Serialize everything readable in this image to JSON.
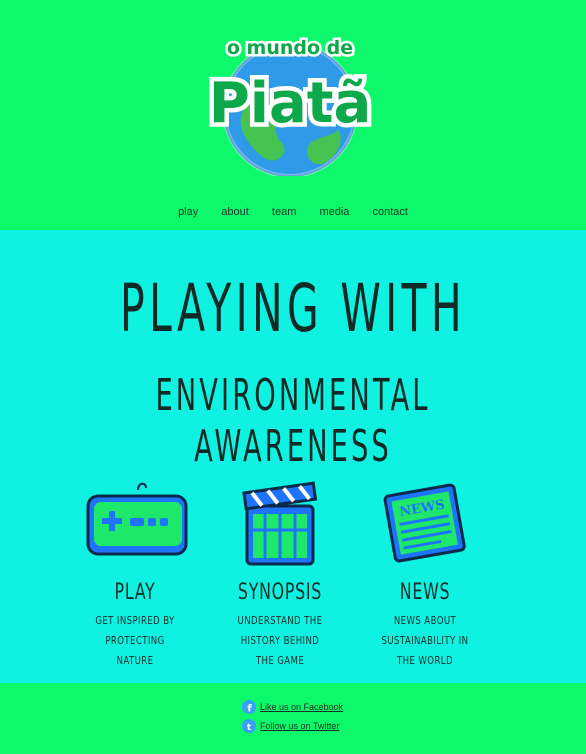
{
  "header": {
    "logo_small": "o mundo de",
    "logo_big": "Piatã"
  },
  "nav": [
    "play",
    "about",
    "team",
    "media",
    "contact"
  ],
  "hero": {
    "line1": "PLAYING WITH",
    "line2": "ENVIRONMENTAL AWARENESS"
  },
  "features": [
    {
      "title": "PLAY",
      "desc_lines": [
        "GET INSPIRED BY PROTECTING",
        "NATURE"
      ]
    },
    {
      "title": "SYNOPSIS",
      "desc_lines": [
        "UNDERSTAND THE HISTORY BEHIND",
        "THE GAME"
      ]
    },
    {
      "title": "NEWS",
      "desc_lines": [
        "NEWS ABOUT SUSTAINABILITY IN",
        "THE WORLD"
      ]
    }
  ],
  "footer": {
    "facebook": "Like us on Facebook",
    "twitter": "Follow us on Twitter"
  },
  "colors": {
    "header_bg": "#0df86a",
    "main_bg": "#0ff1e1",
    "icon_blue": "#1f74ff",
    "icon_green": "#1ee86a"
  }
}
